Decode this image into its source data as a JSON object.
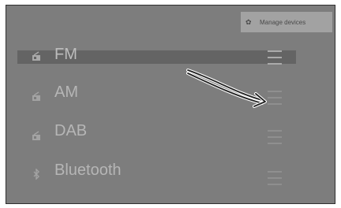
{
  "manage_devices": {
    "label": "Manage devices",
    "icon": "gear-icon"
  },
  "sources": [
    {
      "label": "FM",
      "icon": "radio-icon",
      "selected": true
    },
    {
      "label": "AM",
      "icon": "radio-icon",
      "selected": false
    },
    {
      "label": "DAB",
      "icon": "radio-icon",
      "selected": false
    },
    {
      "label": "Bluetooth",
      "icon": "bluetooth-icon",
      "selected": false
    }
  ],
  "colors": {
    "screen_background": "#7d7d7d",
    "selected_row": "#646464",
    "label_text": "#b6b6b6"
  }
}
